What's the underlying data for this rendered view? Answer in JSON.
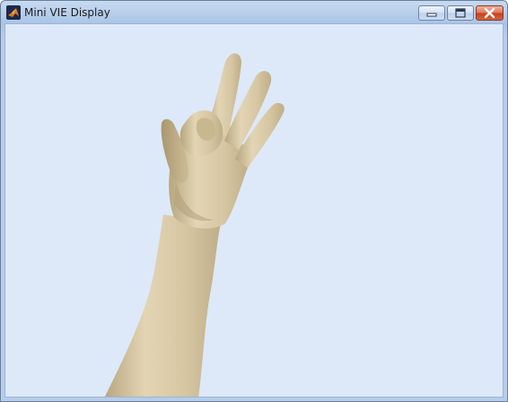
{
  "window": {
    "title": "Mini VIE Display",
    "app_icon": "matlab-icon",
    "controls": {
      "minimize": "minimize-icon",
      "maximize": "maximize-icon",
      "close": "close-icon"
    }
  },
  "viewport": {
    "background_color": "#dde9f9",
    "model_color": "#d8c9a5"
  }
}
